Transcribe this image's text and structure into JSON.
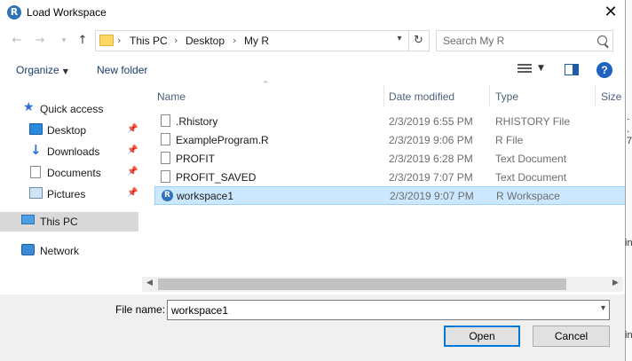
{
  "window": {
    "title": "Load Workspace",
    "app_icon": "R",
    "close_glyph": "✕"
  },
  "nav": {
    "back_icon": "arrow-left-icon",
    "forward_icon": "arrow-right-icon",
    "recent_icon": "chevron-down-icon",
    "up_icon": "arrow-up-icon"
  },
  "address": {
    "crumbs": [
      "This PC",
      "Desktop",
      "My R"
    ],
    "separator": "›"
  },
  "search": {
    "placeholder": "Search My R"
  },
  "toolbar": {
    "organize_label": "Organize",
    "new_folder_label": "New folder",
    "help_label": "?"
  },
  "sidebar": {
    "items": [
      {
        "label": "Quick access",
        "icon": "star-icon",
        "pinned": false
      },
      {
        "label": "Desktop",
        "icon": "desktop-icon",
        "pinned": true
      },
      {
        "label": "Downloads",
        "icon": "download-icon",
        "pinned": true
      },
      {
        "label": "Documents",
        "icon": "documents-icon",
        "pinned": true
      },
      {
        "label": "Pictures",
        "icon": "pictures-icon",
        "pinned": true
      },
      {
        "label": "This PC",
        "icon": "computer-icon",
        "selected": true
      },
      {
        "label": "Network",
        "icon": "network-icon"
      }
    ]
  },
  "columns": {
    "name": "Name",
    "date": "Date modified",
    "type": "Type",
    "size": "Size"
  },
  "files": [
    {
      "name": ".Rhistory",
      "date": "2/3/2019 6:55 PM",
      "type": "RHISTORY File",
      "icon": "file-icon"
    },
    {
      "name": "ExampleProgram.R",
      "date": "2/3/2019 9:06 PM",
      "type": "R File",
      "icon": "file-icon"
    },
    {
      "name": "PROFIT",
      "date": "2/3/2019 6:28 PM",
      "type": "Text Document",
      "icon": "file-icon"
    },
    {
      "name": "PROFIT_SAVED",
      "date": "2/3/2019 7:07 PM",
      "type": "Text Document",
      "icon": "file-icon"
    },
    {
      "name": "workspace1",
      "date": "2/3/2019 9:07 PM",
      "type": "R Workspace",
      "icon": "r-workspace-icon",
      "selected": true
    }
  ],
  "filename": {
    "label": "File name:",
    "value": "workspace1"
  },
  "buttons": {
    "open": "Open",
    "cancel": "Cancel"
  },
  "background_window": {
    "fragments": [
      ".",
      ".",
      "7",
      "in",
      "in"
    ]
  },
  "colors": {
    "selection_bg": "#cce8ff",
    "selection_border": "#99d1ff",
    "accent": "#0078d7"
  }
}
